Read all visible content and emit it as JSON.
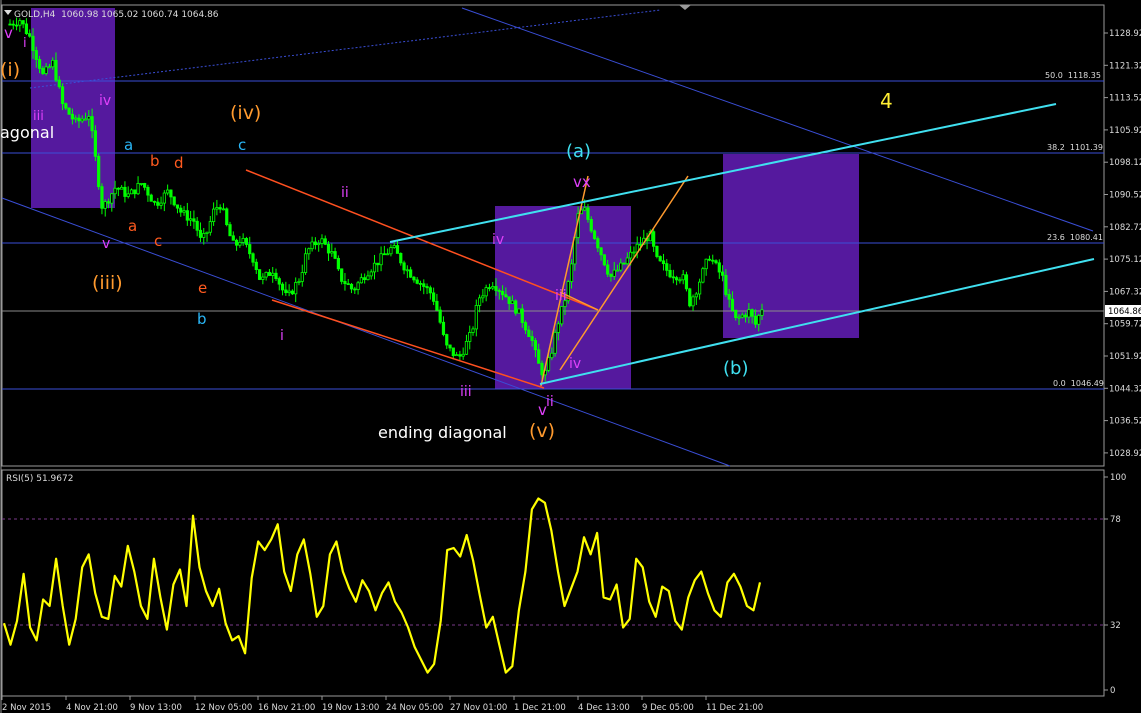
{
  "window": {
    "symbol_title": "GOLD,H4  1060.98 1065.02 1060.74 1064.86",
    "rsi_title": "RSI(5) 51.9672"
  },
  "price_axis": {
    "ticks": [
      "1128.92",
      "1121.32",
      "1113.52",
      "1105.92",
      "1098.12",
      "1090.52",
      "1082.72",
      "1075.12",
      "1067.32",
      "1059.72",
      "1051.92",
      "1044.32",
      "1036.52",
      "1028.92"
    ],
    "current_price": "1064.86"
  },
  "rsi_axis": {
    "ticks": [
      "100",
      "78",
      "32",
      "0"
    ]
  },
  "time_axis": {
    "labels": [
      "2 Nov 2015",
      "4 Nov 21:00",
      "9 Nov 13:00",
      "12 Nov 05:00",
      "16 Nov 21:00",
      "19 Nov 13:00",
      "24 Nov 05:00",
      "27 Nov 01:00",
      "1 Dec 21:00",
      "4 Dec 13:00",
      "9 Dec 05:00",
      "11 Dec 21:00"
    ]
  },
  "fibonacci": {
    "levels": [
      "50.0  1118.35",
      "38.2  1101.39",
      "23.6  1080.41",
      "0.0  1046.49"
    ]
  },
  "wave_labels": [
    {
      "text": "v",
      "color": "#e040fb"
    },
    {
      "text": "i",
      "color": "#e040fb"
    },
    {
      "text": "(i)",
      "color": "#ff9a2e"
    },
    {
      "text": "iii",
      "color": "#e040fb"
    },
    {
      "text": "agonal",
      "color": "#ffffff"
    },
    {
      "text": "iv",
      "color": "#e040fb"
    },
    {
      "text": "a",
      "color": "#29b6f6"
    },
    {
      "text": "b",
      "color": "#ff5a1f"
    },
    {
      "text": "d",
      "color": "#ff5a1f"
    },
    {
      "text": "(iv)",
      "color": "#ff9a2e"
    },
    {
      "text": "c",
      "color": "#29b6f6"
    },
    {
      "text": "a",
      "color": "#ff5a1f"
    },
    {
      "text": "c",
      "color": "#ff5a1f"
    },
    {
      "text": "v",
      "color": "#e040fb"
    },
    {
      "text": "(iii)",
      "color": "#ff9a2e"
    },
    {
      "text": "e",
      "color": "#ff5a1f"
    },
    {
      "text": "b",
      "color": "#29b6f6"
    },
    {
      "text": "ii",
      "color": "#e040fb"
    },
    {
      "text": "i",
      "color": "#e040fb"
    },
    {
      "text": "iii",
      "color": "#e040fb"
    },
    {
      "text": "iv",
      "color": "#e040fb"
    },
    {
      "text": "iii",
      "color": "#e040fb"
    },
    {
      "text": "iv",
      "color": "#e040fb"
    },
    {
      "text": "v",
      "color": "#e040fb"
    },
    {
      "text": "ii",
      "color": "#e040fb"
    },
    {
      "text": "ending diagonal",
      "color": "#ffffff"
    },
    {
      "text": "(v)",
      "color": "#ff9a2e"
    },
    {
      "text": "(a)",
      "color": "#40e0f0"
    },
    {
      "text": "vx",
      "color": "#e040fb"
    },
    {
      "text": "(b)",
      "color": "#40e0f0"
    },
    {
      "text": "4",
      "color": "#ffee33"
    }
  ],
  "colors": {
    "background": "#000000",
    "bull_candle": "#00ff00",
    "axis_text": "#dcdcdc",
    "fib_lines": "#3a4ed6",
    "zones": "#5a1aa6",
    "rsi_line": "#ffff00",
    "channel_cyan": "#40e0f0",
    "channel_red": "#ff5020",
    "fan_orange": "#ff9a2e"
  },
  "chart_data": [
    {
      "type": "candlestick",
      "title": "GOLD,H4  1060.98 1065.02 1060.74 1064.86",
      "x_categories": [
        "2 Nov 2015",
        "4 Nov 21:00",
        "9 Nov 13:00",
        "12 Nov 05:00",
        "16 Nov 21:00",
        "19 Nov 13:00",
        "24 Nov 05:00",
        "27 Nov 01:00",
        "1 Dec 21:00",
        "4 Dec 13:00",
        "9 Dec 05:00",
        "11 Dec 21:00"
      ],
      "ylim": [
        1028.92,
        1133.0
      ],
      "close_path": [
        [
          0,
          1131.0
        ],
        [
          1.5,
          1132.0
        ],
        [
          3,
          1128.0
        ],
        [
          5,
          1119.0
        ],
        [
          6.5,
          1122.0
        ],
        [
          8,
          1112.0
        ],
        [
          10,
          1108.0
        ],
        [
          12,
          1110.0
        ],
        [
          13,
          1099.0
        ],
        [
          14,
          1088.0
        ],
        [
          16,
          1093.0
        ],
        [
          18,
          1091.0
        ],
        [
          20,
          1094.0
        ],
        [
          22,
          1089.0
        ],
        [
          24,
          1092.0
        ],
        [
          26,
          1087.0
        ],
        [
          28,
          1085.0
        ],
        [
          29,
          1080.0
        ],
        [
          30,
          1083.0
        ],
        [
          31,
          1088.0
        ],
        [
          32,
          1089.0
        ],
        [
          33,
          1083.0
        ],
        [
          34,
          1079.0
        ],
        [
          35,
          1081.0
        ],
        [
          37,
          1076.0
        ],
        [
          38,
          1071.0
        ],
        [
          40,
          1074.0
        ],
        [
          41,
          1070.0
        ],
        [
          42,
          1067.0
        ],
        [
          44,
          1072.0
        ],
        [
          45,
          1078.0
        ],
        [
          47,
          1081.0
        ],
        [
          49,
          1077.0
        ],
        [
          50,
          1072.0
        ],
        [
          52,
          1069.0
        ],
        [
          54,
          1073.0
        ],
        [
          56,
          1076.0
        ],
        [
          58,
          1079.0
        ],
        [
          60,
          1074.0
        ],
        [
          62,
          1071.0
        ],
        [
          64,
          1068.0
        ],
        [
          65,
          1063.0
        ],
        [
          66,
          1056.0
        ],
        [
          68,
          1053.0
        ],
        [
          70,
          1059.0
        ],
        [
          71,
          1067.0
        ],
        [
          73,
          1071.0
        ],
        [
          75,
          1068.0
        ],
        [
          77,
          1064.0
        ],
        [
          79,
          1058.0
        ],
        [
          80,
          1052.0
        ],
        [
          81,
          1049.0
        ],
        [
          82,
          1054.0
        ],
        [
          83,
          1061.0
        ],
        [
          84,
          1066.0
        ],
        [
          85,
          1073.0
        ],
        [
          86,
          1086.0
        ],
        [
          87,
          1088.0
        ],
        [
          88,
          1084.0
        ],
        [
          90,
          1076.0
        ],
        [
          91,
          1072.0
        ],
        [
          93,
          1075.0
        ],
        [
          95,
          1079.0
        ],
        [
          97,
          1082.0
        ],
        [
          98,
          1076.0
        ],
        [
          100,
          1073.0
        ],
        [
          102,
          1072.0
        ],
        [
          103,
          1066.0
        ],
        [
          104,
          1069.0
        ],
        [
          106,
          1077.0
        ],
        [
          108,
          1072.0
        ],
        [
          109,
          1066.0
        ],
        [
          110,
          1062.0
        ],
        [
          112,
          1064.0
        ],
        [
          113,
          1061.0
        ],
        [
          114,
          1064.86
        ]
      ],
      "fib_levels": [
        {
          "ratio": "50.0",
          "value": 1118.35
        },
        {
          "ratio": "38.2",
          "value": 1101.39
        },
        {
          "ratio": "23.6",
          "value": 1080.41
        },
        {
          "ratio": "0.0",
          "value": 1046.49
        }
      ]
    },
    {
      "type": "line",
      "title": "RSI(5) 51.9672",
      "ylim": [
        0,
        100
      ],
      "levels": [
        78,
        32
      ],
      "series": [
        {
          "values": [
            32,
            22,
            33,
            55,
            30,
            24,
            43,
            40,
            62,
            40,
            22,
            34,
            58,
            64,
            46,
            35,
            34,
            54,
            49,
            68,
            56,
            40,
            34,
            62,
            44,
            29,
            50,
            57,
            40,
            82,
            58,
            47,
            40,
            48,
            32,
            24,
            26,
            18,
            53,
            70,
            66,
            71,
            78,
            56,
            47,
            64,
            71,
            55,
            35,
            40,
            64,
            70,
            56,
            48,
            42,
            52,
            47,
            38,
            46,
            51,
            42,
            37,
            30,
            21,
            15,
            9,
            13,
            33,
            66,
            67,
            63,
            73,
            61,
            45,
            30,
            35,
            22,
            9,
            12,
            38,
            56,
            85,
            90,
            88,
            75,
            56,
            40,
            48,
            56,
            72,
            64,
            74,
            44,
            43,
            50,
            30,
            34,
            62,
            58,
            42,
            35,
            49,
            47,
            33,
            29,
            44,
            52,
            56,
            46,
            38,
            35,
            51,
            55,
            49,
            40,
            38,
            51
          ]
        }
      ]
    }
  ]
}
